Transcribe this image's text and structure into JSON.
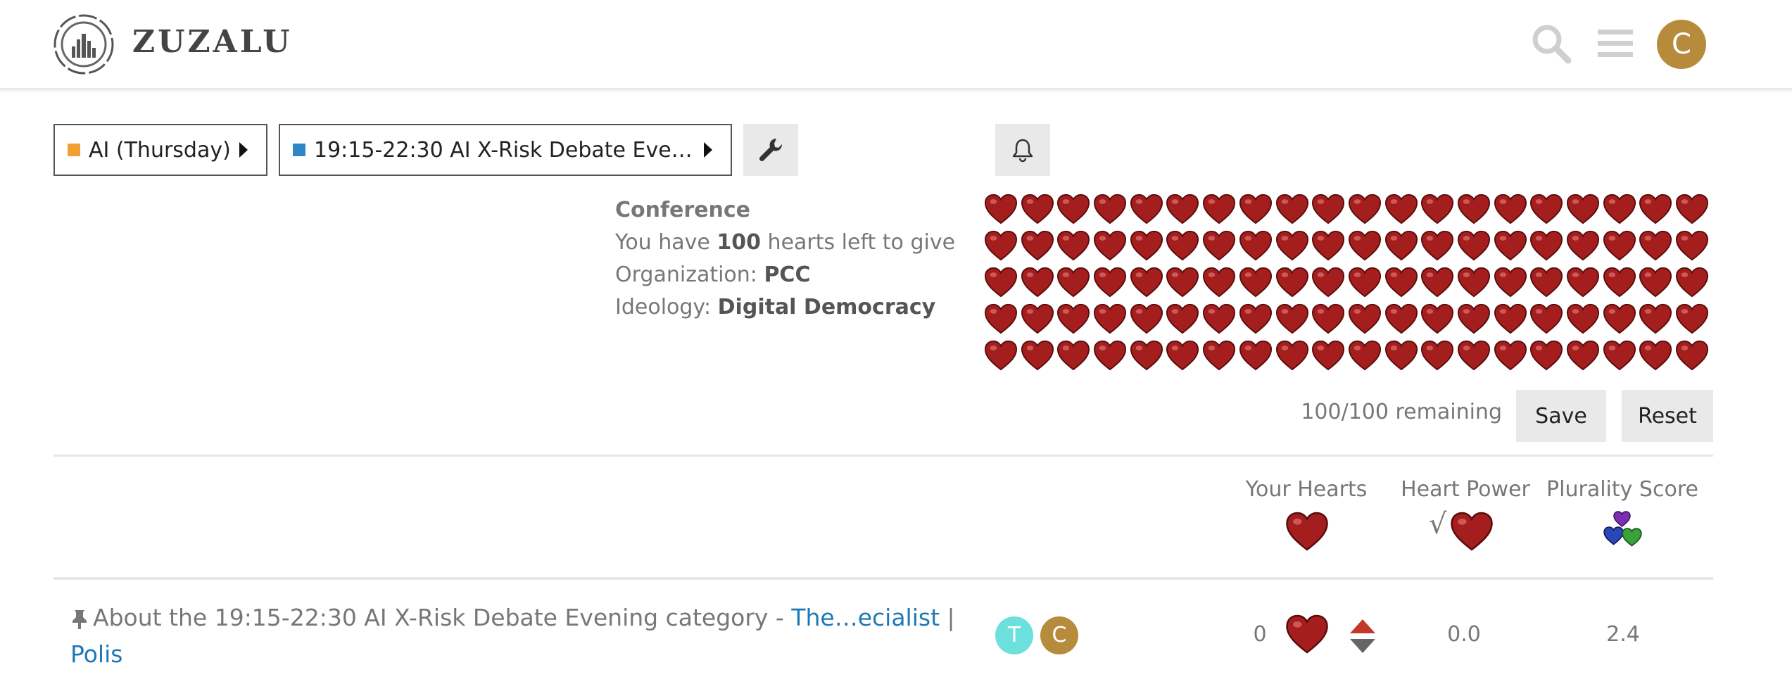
{
  "header": {
    "brand": "ZUZALU",
    "avatar_letter": "C",
    "avatar_color": "#b78b3c"
  },
  "nav": {
    "category": {
      "label": "AI (Thursday)",
      "color": "#f0a030"
    },
    "subcategory": {
      "label": "19:15-22:30 AI X-Risk Debate Eve…",
      "color": "#2e86c8"
    }
  },
  "info": {
    "title": "Conference",
    "hearts_prefix": "You have ",
    "hearts_value": "100",
    "hearts_suffix": " hearts left to give",
    "org_label": "Organization: ",
    "org_value": "PCC",
    "ideology_label": "Ideology: ",
    "ideology_value": "Digital Democracy"
  },
  "hearts": {
    "total": 100,
    "per_row": 20,
    "color": "#a41e1e"
  },
  "remaining_text": "100/100 remaining",
  "buttons": {
    "save": "Save",
    "reset": "Reset"
  },
  "columns": {
    "your_hearts": "Your Hearts",
    "heart_power": "Heart Power",
    "plurality_score": "Plurality Score",
    "sqrt_symbol": "√"
  },
  "topic": {
    "title_text": "About the 19:15-22:30 AI X-Risk Debate Evening category - ",
    "link1": "The…ecialist",
    "separator": " | ",
    "link2": "Polis",
    "posters": [
      {
        "letter": "T",
        "color": "#6be0dc"
      },
      {
        "letter": "C",
        "color": "#b78b3c"
      }
    ],
    "your_hearts": "0",
    "heart_power": "0.0",
    "plurality_score": "2.4"
  }
}
